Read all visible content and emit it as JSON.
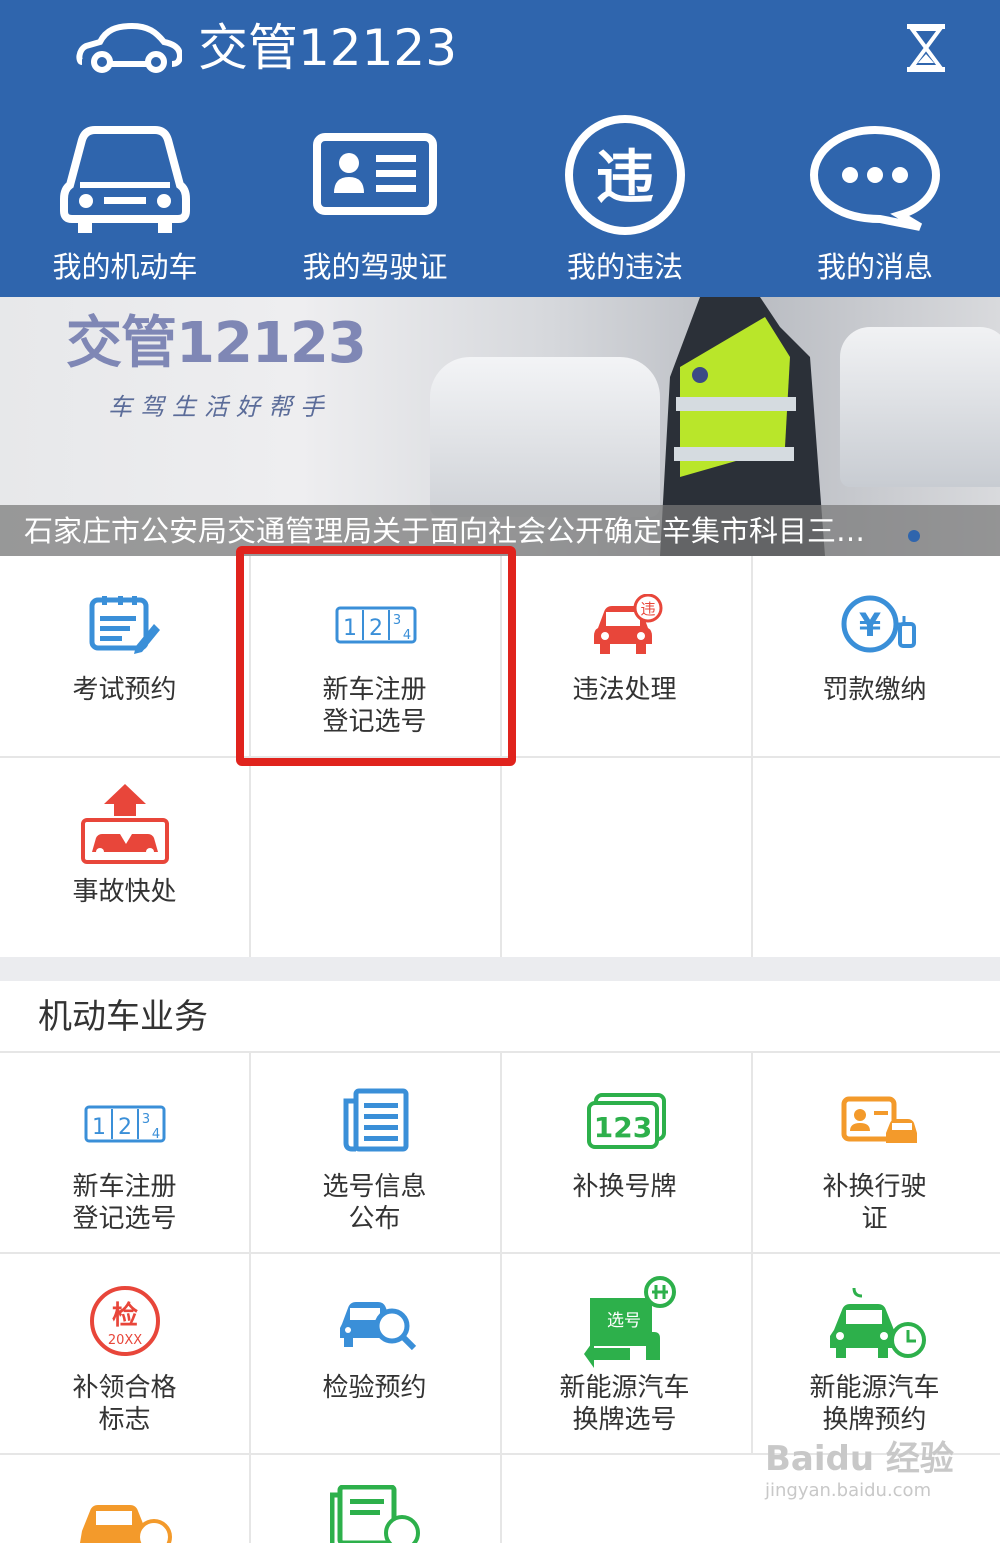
{
  "header": {
    "title": "交管12123",
    "nav": [
      {
        "label": "我的机动车",
        "icon": "car-icon"
      },
      {
        "label": "我的驾驶证",
        "icon": "license-card-icon"
      },
      {
        "label": "我的违法",
        "icon": "violation-icon"
      },
      {
        "label": "我的消息",
        "icon": "message-bubble-icon"
      }
    ],
    "violation_glyph": "违"
  },
  "banner": {
    "logo": "交管12123",
    "slogan": "车驾生活好帮手",
    "caption": "石家庄市公安局交通管理局关于面向社会公开确定辛集市科目三…"
  },
  "quick_services": [
    {
      "label": "考试预约",
      "icon": "exam-booking-icon"
    },
    {
      "label": "新车注册\n登记选号",
      "icon": "plate-number-select-icon",
      "line1": "新车注册",
      "line2": "登记选号"
    },
    {
      "label": "违法处理",
      "icon": "violation-car-icon",
      "badge": "违"
    },
    {
      "label": "罚款缴纳",
      "icon": "fine-payment-icon",
      "symbol": "¥"
    },
    {
      "label": "事故快处",
      "icon": "accident-icon"
    }
  ],
  "section": {
    "title": "机动车业务",
    "items": [
      {
        "line1": "新车注册",
        "line2": "登记选号",
        "icon": "plate-number-select-icon"
      },
      {
        "line1": "选号信息",
        "line2": "公布",
        "icon": "news-icon"
      },
      {
        "line1": "补换号牌",
        "line2": "",
        "icon": "plate-replace-icon",
        "plate_text": "123"
      },
      {
        "line1": "补换行驶",
        "line2": "证",
        "icon": "driving-permit-icon"
      },
      {
        "line1": "补领合格",
        "line2": "标志",
        "icon": "inspection-mark-icon",
        "stamp_text": "检",
        "stamp_year": "20XX"
      },
      {
        "line1": "检验预约",
        "line2": "",
        "icon": "inspection-booking-icon"
      },
      {
        "line1": "新能源汽车",
        "line2": "换牌选号",
        "icon": "ev-plate-select-icon",
        "tag": "选号"
      },
      {
        "line1": "新能源汽车",
        "line2": "换牌预约",
        "icon": "ev-plate-booking-icon"
      }
    ]
  },
  "watermark": {
    "line1": "Baidu 经验",
    "line2": "jingyan.baidu.com"
  },
  "colors": {
    "header_bg": "#2f65ad",
    "highlight": "#e0231d",
    "blue_icon": "#3a8fd8",
    "red_icon": "#e8463a",
    "green_icon": "#2db04b",
    "orange_icon": "#f39a2b"
  }
}
